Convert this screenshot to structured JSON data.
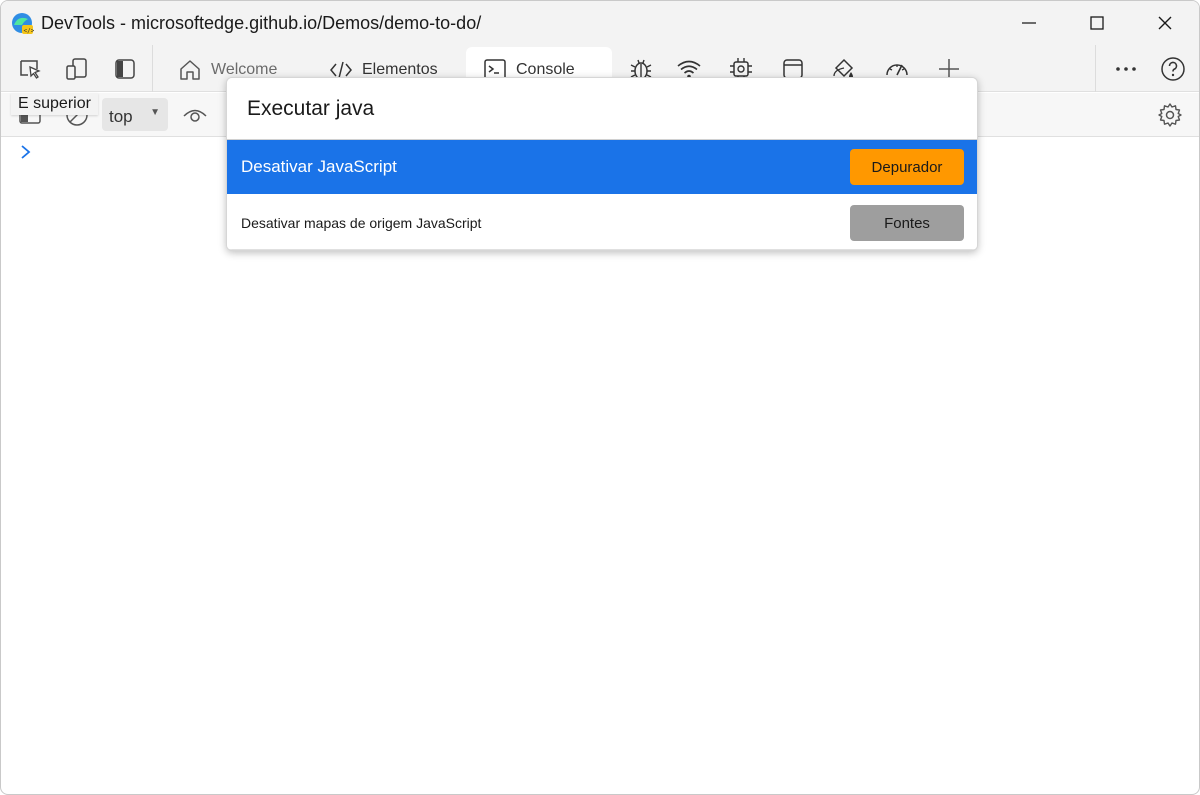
{
  "window": {
    "title": "DevTools - microsoftedge.github.io/Demos/demo-to-do/"
  },
  "tabs": [
    {
      "label": "Welcome",
      "icon": "home-icon"
    },
    {
      "label": "Elementos",
      "icon": "code-icon"
    },
    {
      "label": "Console",
      "icon": "console-icon",
      "active": true
    }
  ],
  "toolbar": {
    "context_value": "top",
    "tooltip": "E superior"
  },
  "command_menu": {
    "input_value": "Executar java",
    "items": [
      {
        "label": "Desativar JavaScript",
        "badge": "Depurador",
        "badge_color": "#ff9800",
        "selected": true
      },
      {
        "label": "Desativar mapas de origem JavaScript",
        "badge": "Fontes",
        "badge_color": "#9e9e9e",
        "selected": false
      }
    ]
  },
  "colors": {
    "accent": "#1a73e8",
    "prompt": "#1a73e8"
  }
}
